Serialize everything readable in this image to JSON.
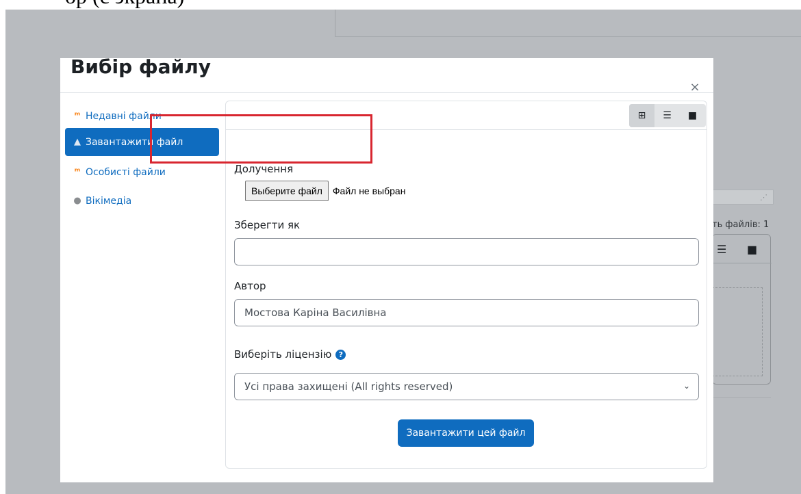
{
  "top_fragment": "ор (с экрана)",
  "background": {
    "file_count_label": "ть файлів: 1"
  },
  "dialog": {
    "title": "Вибір файлу",
    "close_glyph": "×"
  },
  "sidebar": {
    "items": [
      {
        "label": "Недавні файли",
        "icon": "moodle-icon",
        "active": false
      },
      {
        "label": "Завантажити файл",
        "icon": "upload-icon",
        "active": true
      },
      {
        "label": "Особисті файли",
        "icon": "moodle-icon",
        "active": false
      },
      {
        "label": "Вікімедіа",
        "icon": "wikimedia-icon",
        "active": false
      }
    ]
  },
  "toolbar": {
    "views": [
      "icons-view-icon",
      "list-view-icon",
      "tree-view-icon"
    ]
  },
  "form": {
    "attachment_label": "Долучення",
    "file_button_label": "Выберите файл",
    "file_status": "Файл не выбран",
    "save_as_label": "Зберегти як",
    "save_as_value": "",
    "author_label": "Автор",
    "author_value": "Мостова Каріна Василівна",
    "license_label": "Виберіть ліцензію",
    "license_value": "Усі права захищені (All rights reserved)",
    "submit_label": "Завантажити цей файл"
  },
  "colors": {
    "primary": "#0f6cbf",
    "highlight_box": "#d8262f",
    "overlay": "#b8bbbf"
  }
}
